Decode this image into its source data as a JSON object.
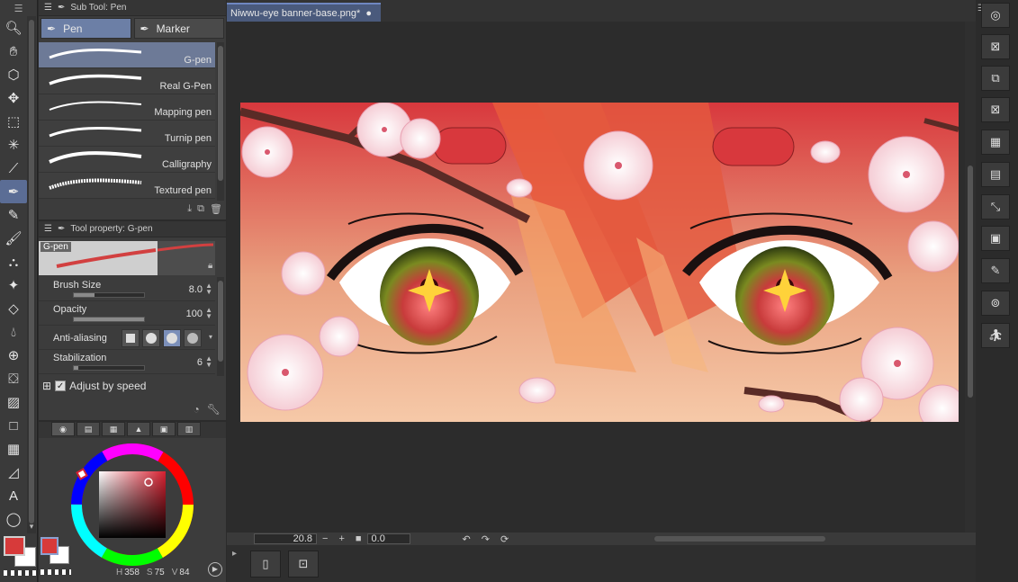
{
  "subtool": {
    "title": "Sub Tool: Pen",
    "tabs": [
      {
        "label": "Pen"
      },
      {
        "label": "Marker"
      }
    ],
    "brushes": [
      {
        "label": "G-pen"
      },
      {
        "label": "Real G-Pen"
      },
      {
        "label": "Mapping pen"
      },
      {
        "label": "Turnip pen"
      },
      {
        "label": "Calligraphy"
      },
      {
        "label": "Textured pen"
      }
    ]
  },
  "toolprop": {
    "title": "Tool property: G-pen",
    "preview_label": "G-pen",
    "brush_size": {
      "label": "Brush Size",
      "value": "8.0",
      "fill": 0.3
    },
    "opacity": {
      "label": "Opacity",
      "value": "100",
      "fill": 1.0
    },
    "anti_aliasing": {
      "label": "Anti-aliasing",
      "selected_index": 2
    },
    "stabilization": {
      "label": "Stabilization",
      "value": "6",
      "fill": 0.06
    },
    "adjust_by_speed": {
      "label": "Adjust by speed",
      "checked": true
    }
  },
  "color": {
    "main": "#d73a3a",
    "sub": "#ffffff",
    "hsv": {
      "h": "358",
      "s": "75",
      "v": "84"
    }
  },
  "document": {
    "tab_label": "Niwwu-eye banner-base.png*"
  },
  "status": {
    "zoom": "20.8",
    "rotation": "0.0"
  },
  "accent": "#6c7fa6"
}
